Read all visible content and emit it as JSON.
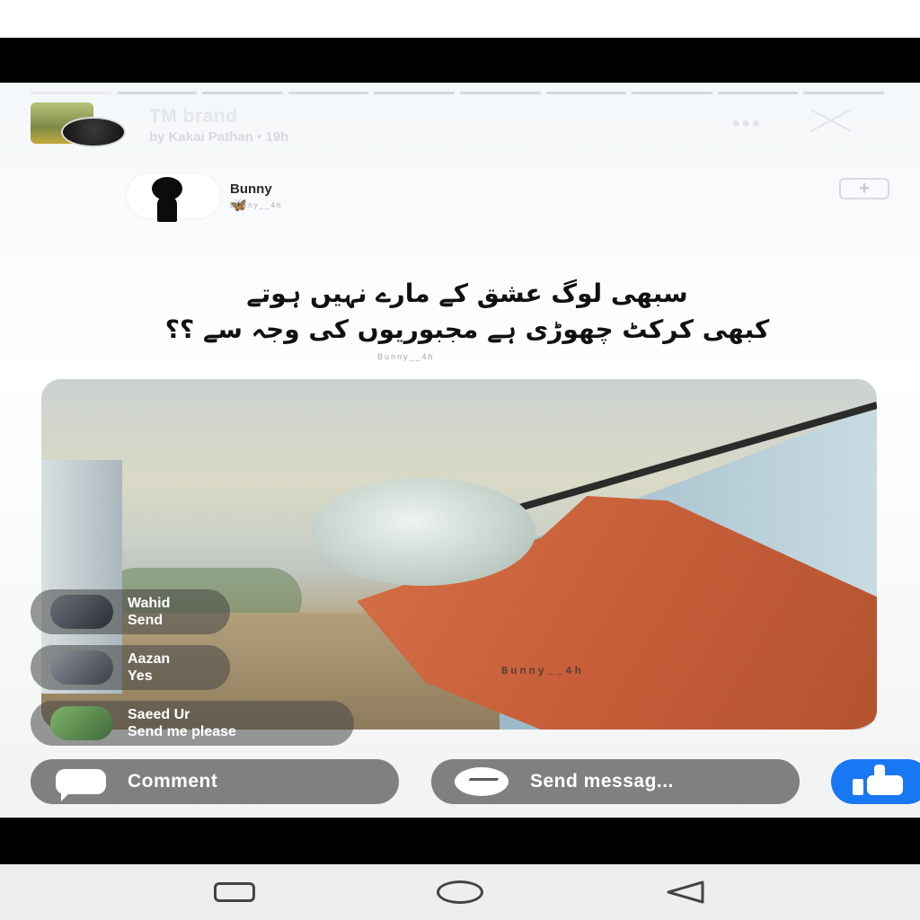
{
  "story": {
    "title": "TM brand",
    "subtitle": "by Kakai Pathan • 19h"
  },
  "post": {
    "name": "Bunny🦋",
    "handle": "Bunny__4h",
    "urdu_line1": "سبھی لوگ عشق کے مارے نہیں ہوتے",
    "urdu_line2": "کبھی کرکٹ چھوڑی ہے مجبوریوں کی وجہ سے ؟؟",
    "urdu_handle": "Bunny__4h",
    "photo_handle": "Bunny__4h"
  },
  "comments": [
    {
      "name": "Wahid",
      "message": "Send"
    },
    {
      "name": "Aazan",
      "message": "Yes"
    },
    {
      "name": "Saeed Ur",
      "message": "Send me please"
    }
  ],
  "actions": {
    "comment_label": "Comment",
    "send_label": "Send messag..."
  },
  "icons": {
    "more": "more-icon",
    "close": "close-icon",
    "add": "add-icon",
    "comment": "comment-bubble-icon",
    "messenger": "messenger-icon",
    "like": "thumbs-up-icon"
  },
  "colors": {
    "like": "#1877f2",
    "pill": "#5a5a5a"
  },
  "story_progress": {
    "segments": 10,
    "current": 1
  }
}
